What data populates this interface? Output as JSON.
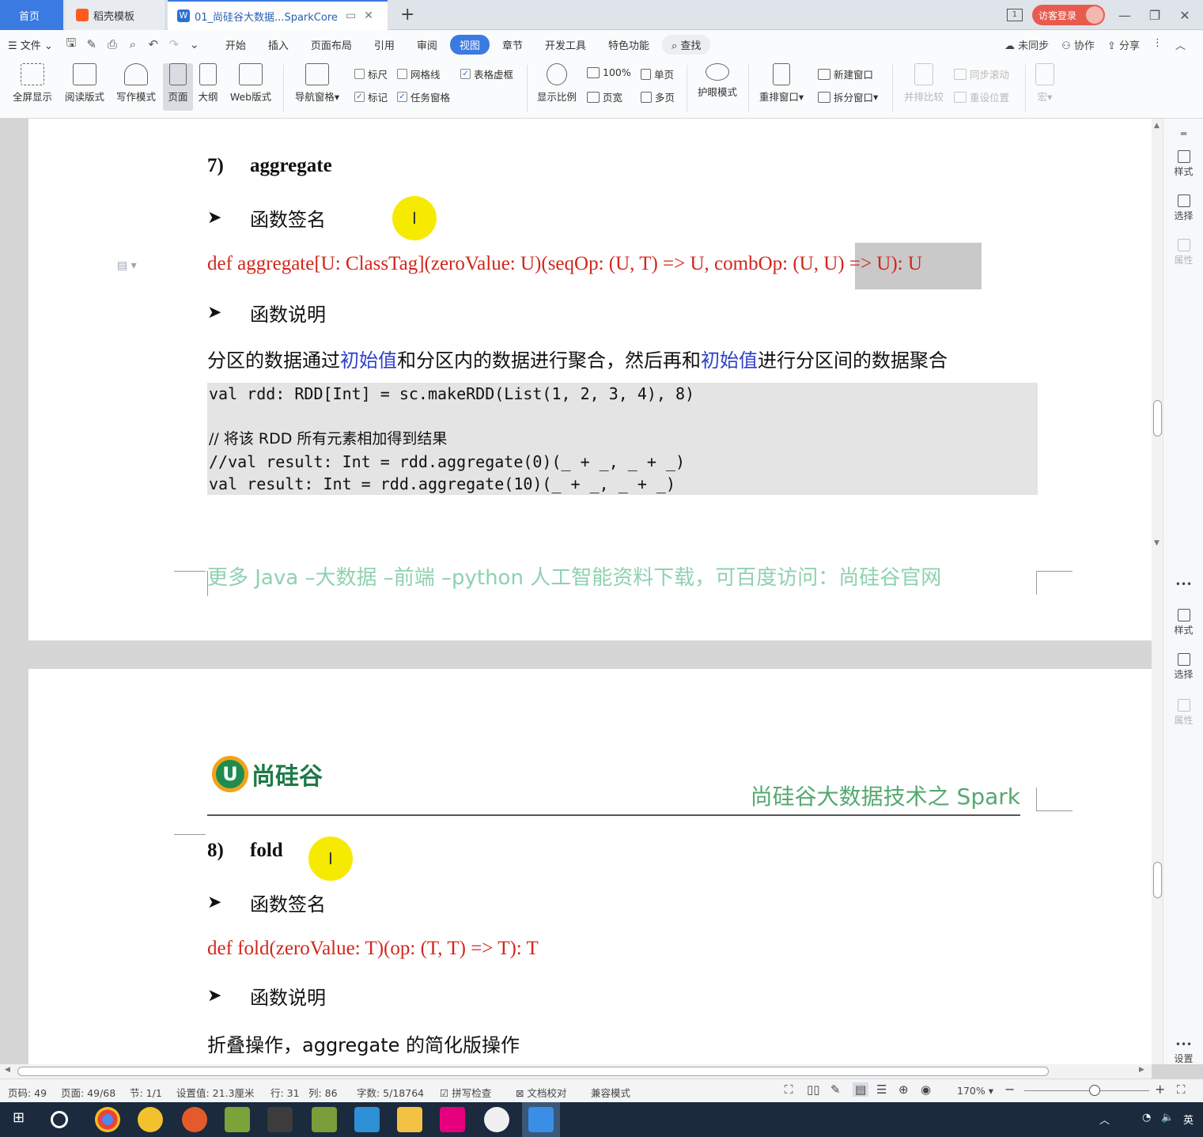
{
  "tabs": {
    "home": "首页",
    "wps": "稻壳模板",
    "doc": "01_尚硅谷大数据...SparkCore",
    "doc_icon": "W"
  },
  "titlebar": {
    "page_count_icon": "1",
    "login": "访客登录"
  },
  "menu": {
    "file": "文件",
    "items": [
      "开始",
      "插入",
      "页面布局",
      "引用",
      "审阅",
      "视图",
      "章节",
      "开发工具",
      "特色功能"
    ],
    "active": "视图",
    "search": "查找",
    "right": [
      "未同步",
      "协作",
      "分享"
    ]
  },
  "ribbon": {
    "fullscreen": "全屏显示",
    "reading": "阅读版式",
    "writing": "写作模式",
    "page": "页面",
    "outline": "大纲",
    "web": "Web版式",
    "nav": "导航窗格",
    "ruler": "标尺",
    "gridlines": "网格线",
    "table_dotted": "表格虚框",
    "marks": "标记",
    "task_pane": "任务窗格",
    "zoom": "显示比例",
    "pct100": "100%",
    "single_page": "单页",
    "page_width": "页宽",
    "multi_page": "多页",
    "eye_care": "护眼模式",
    "rearrange": "重排窗口",
    "new_window": "新建窗口",
    "split_window": "拆分窗口",
    "side_by_side": "并排比较",
    "sync_scroll": "同步滚动",
    "reset_position": "重设位置",
    "macro": "宏"
  },
  "page1": {
    "heading_num": "7)",
    "heading": "aggregate",
    "sig_label": "函数签名",
    "sig": "def aggregate[U: ClassTag](zeroValue: U)(seqOp: (U, T) => U, combOp: (U, U) => U): U",
    "desc_label": "函数说明",
    "desc_parts": [
      "分区的数据通过",
      "初始值",
      "和分区内的数据进行聚合，然后再和",
      "初始值",
      "进行分区间的数据聚合"
    ],
    "code": [
      "val rdd: RDD[Int] = sc.makeRDD(List(1, 2, 3, 4), 8)",
      "",
      "// 将该 RDD 所有元素相加得到结果",
      "//val result: Int = rdd.aggregate(0)(_ + _, _ + _)",
      "val result: Int = rdd.aggregate(10)(_ + _, _ + _)"
    ],
    "footer": "更多 Java –大数据 –前端 –python 人工智能资料下载，可百度访问：尚硅谷官网"
  },
  "page2": {
    "logo_mark": "U",
    "logo_text": "尚硅谷",
    "header_title": "尚硅谷大数据技术之 Spark",
    "heading_num": "8)",
    "heading": "fold",
    "sig_label": "函数签名",
    "sig": "def fold(zeroValue: T)(op: (T, T) => T): T",
    "desc_label": "函数说明",
    "desc": "折叠操作，aggregate 的简化版操作"
  },
  "right_panel": {
    "style": "样式",
    "select": "选择",
    "props": "属性",
    "settings": "设置",
    "more": "•••"
  },
  "status": {
    "page_num": "页码: 49",
    "pages": "页面: 49/68",
    "section": "节: 1/1",
    "setting": "设置值: 21.3厘米",
    "row": "行: 31",
    "col": "列: 86",
    "words": "字数: 5/18764",
    "spell": "拼写检查",
    "proof": "文档校对",
    "compat": "兼容模式",
    "zoom": "170%"
  },
  "taskbar": {
    "ime": "英"
  }
}
